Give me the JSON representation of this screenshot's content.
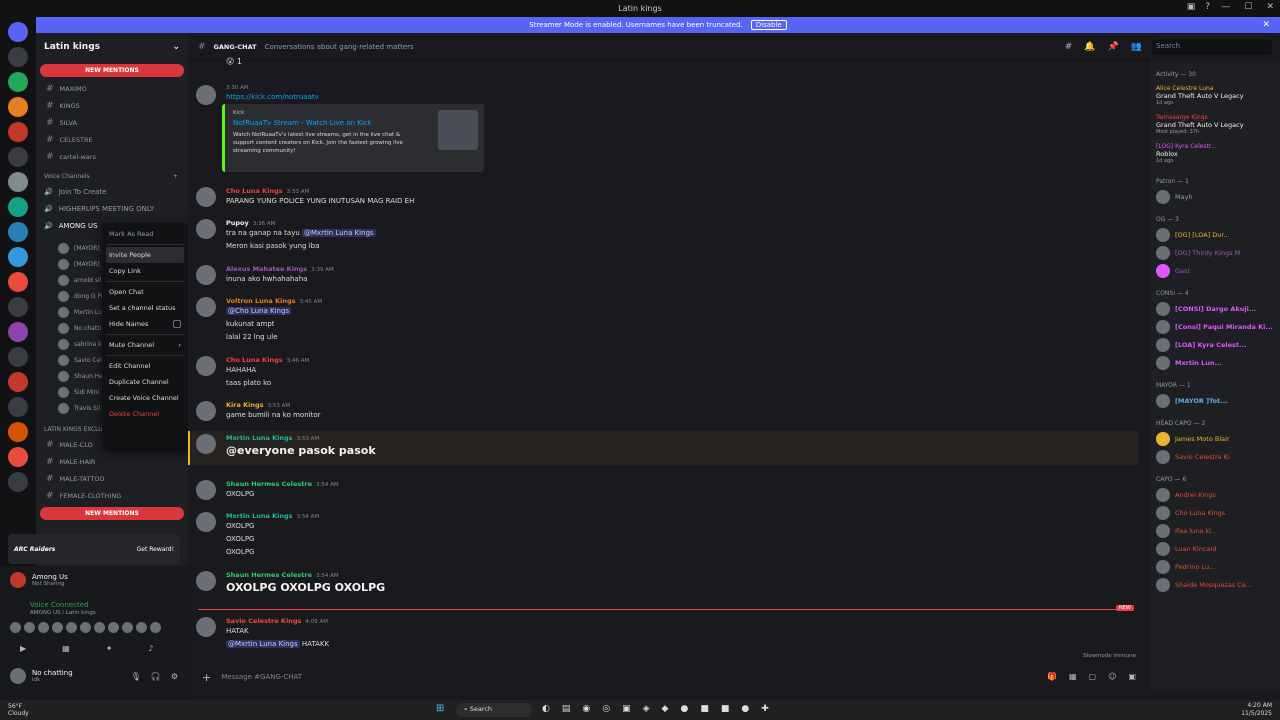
{
  "window": {
    "title": "Latin kings"
  },
  "banner": {
    "text": "Streamer Mode is enabled. Usernames have been truncated.",
    "disable_label": "Disable"
  },
  "sidebar": {
    "guild_name": "Latin kings",
    "new_mentions": "NEW MENTIONS",
    "channels": [
      "MAXIMO",
      "KINGS",
      "SILVA",
      "CELESTRE",
      "cartel-wars"
    ],
    "voice_category": "Voice Channels",
    "voice_channels": [
      "Join To Create",
      "HIGHERUPS MEETING ONLY",
      "AMONG US"
    ],
    "members": [
      "[MAYOR]",
      "[MAYOR]",
      "arnold sil",
      "dong G Pi",
      "Mxrtin Lu",
      "No chatti",
      "sabrina k",
      "Savio Cel",
      "Shaun He",
      "Sidi Mini",
      "Travis Sil"
    ],
    "category2": "LATIN KINGS EXCLUSIV",
    "channels2": [
      "MALE-CLO",
      "MALE-HAIR",
      "MALE-TATTOO",
      "FEMALE-CLOTHING"
    ],
    "new_mentions_bottom": "NEW MENTIONS"
  },
  "context_menu": {
    "items": [
      "Mark As Read",
      "Invite People",
      "Copy Link",
      "Open Chat",
      "Set a channel status",
      "Hide Names",
      "Mute Channel",
      "Edit Channel",
      "Duplicate Channel",
      "Create Voice Channel",
      "Delete Channel"
    ]
  },
  "promo": {
    "text": "ARC Raiders",
    "button": "Get Reward!"
  },
  "user_panel": {
    "activity_name": "Among Us",
    "activity_sub": "Not Sharing",
    "voice_status": "Voice Connected",
    "voice_sub": "AMONG US / Latin kings",
    "username": "No chatting",
    "user_status": "idk"
  },
  "header": {
    "channel": "GANG-CHAT",
    "topic": "Conversations about gang-related matters"
  },
  "search": {
    "placeholder": "Search"
  },
  "messages": [
    {
      "time": "3:30 AM",
      "link": "https://kick.com/notruaatv"
    },
    {
      "user": "Cho Luna Kings",
      "time": "3:33 AM",
      "lines": [
        "PARANG YUNG POLICE YUNG INUTUSAN MAG RAID EH"
      ]
    },
    {
      "user": "Pupoy",
      "time": "3:36 AM",
      "lines": [
        "tra na ganap na tayu",
        "Meron kasi pasok yung iba"
      ],
      "mention": "@Mxrtin Luna Kings"
    },
    {
      "user": "Alexus Mahatee Kings",
      "time": "3:39 AM",
      "lines": [
        "inuna ako hwhahahaha"
      ]
    },
    {
      "user": "Voltron Luna Kings",
      "time": "3:45 AM",
      "mention": "@Cho Luna Kings",
      "lines": [
        "kukunat ampt",
        "lalal 22 lng ule"
      ]
    },
    {
      "user": "Cho Luna Kings",
      "time": "3:46 AM",
      "lines": [
        "HAHAHA",
        "taas plato ko"
      ]
    },
    {
      "user": "Kira Kings",
      "time": "3:53 AM",
      "lines": [
        "game bumili na ko monitor"
      ]
    },
    {
      "user": "Mxrtin Luna Kings",
      "time": "3:53 AM",
      "big": "@everyone pasok pasok"
    },
    {
      "user": "Shaun Hermes Celestre",
      "time": "3:54 AM",
      "lines": [
        "OXOLPG"
      ]
    },
    {
      "user": "Mxrtin Luna Kings",
      "time": "3:54 AM",
      "lines": [
        "OXOLPG",
        "OXOLPG",
        "OXOLPG"
      ]
    },
    {
      "user": "Shaun Hermes Celestre",
      "time": "3:54 AM",
      "big": "OXOLPG OXOLPG OXOLPG"
    },
    {
      "user": "Savio Celestre Kings",
      "time": "4:09 AM",
      "lines": [
        "HATAK"
      ],
      "mention": "@Mxrtin Luna Kings",
      "after": "HATAKK"
    }
  ],
  "embed": {
    "provider": "Kick",
    "title": "NotRuaaTv Stream - Watch Live on Kick",
    "desc": "Watch NotRuaaTv's latest live streams, get in the live chat & support content creators on Kick. Join the fastest growing live streaming community!"
  },
  "input": {
    "placeholder": "Message #GANG-CHAT"
  },
  "new_badge": "NEW",
  "slowmode": "Slowmode immune",
  "member_list": {
    "activity_header": "Activity — 30",
    "activities": [
      {
        "name": "Alice Celestre Luna",
        "game": "Grand Theft Auto V Legacy",
        "time": "1d ago"
      },
      {
        "name": "Twinsaarge Kings",
        "game": "Grand Theft Auto V Legacy",
        "time": "Most played: 37h"
      },
      {
        "name": "[LOG] Kyra Celestr...",
        "game": "Roblox",
        "time": "1d ago"
      }
    ],
    "groups": [
      {
        "label": "Patron — 1",
        "members": [
          "Mayh"
        ]
      },
      {
        "label": "OG — 3",
        "members": [
          "[OG] [LOA] Dur...",
          "[OG] Thirdy Kings M",
          "Gast"
        ]
      },
      {
        "label": "CONSI — 4",
        "members": [
          "[CONSI] Dargo Akuji...",
          "[Consi] Paqui Miranda Ki...",
          "[LOA] Kyra Celest...",
          "Mxrtin Lun..."
        ]
      },
      {
        "label": "MAYOR — 1",
        "members": [
          "[MAYOR ]Tot..."
        ]
      },
      {
        "label": "HEAD CAPO — 2",
        "members": [
          "James Moto Blair",
          "Savio Celestre Ki"
        ]
      },
      {
        "label": "CAPO — 6",
        "members": [
          "Andrei Kings",
          "Cho Luna Kings",
          "Ifea luna ki...",
          "Luan Kincaid",
          "Pedrino Lu...",
          "Shaide Mosquezas Ce..."
        ]
      }
    ]
  },
  "taskbar": {
    "weather_temp": "56°F",
    "weather_desc": "Cloudy",
    "search": "Search",
    "time": "4:20 AM",
    "date": "11/5/2025"
  },
  "colors": {
    "accent": "#5865f2",
    "danger": "#da373c",
    "kick_green": "#53fc18"
  }
}
